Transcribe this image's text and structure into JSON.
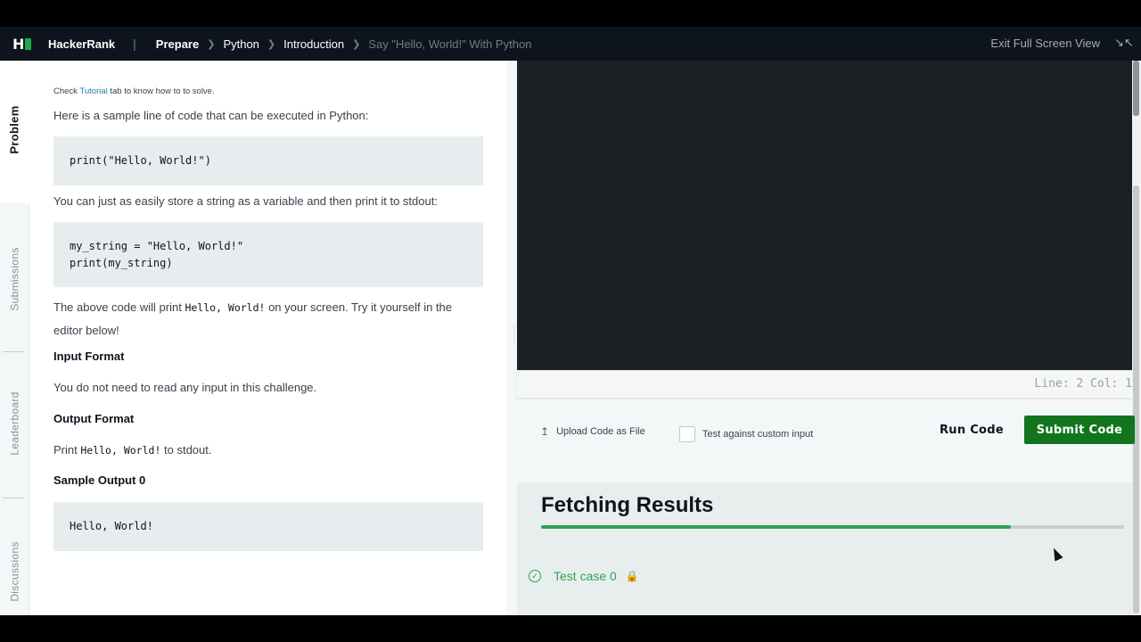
{
  "nav": {
    "brand": "HackerRank",
    "breadcrumbs": [
      "Prepare",
      "Python",
      "Introduction"
    ],
    "current": "Say \"Hello, World!\" With Python",
    "exit_label": "Exit Full Screen View"
  },
  "sidebar": {
    "tabs": [
      "Problem",
      "Submissions",
      "Leaderboard",
      "Discussions"
    ]
  },
  "problem": {
    "hint_prefix": "Check",
    "hint_link": "Tutorial",
    "hint_suffix": "tab to know how to to solve.",
    "intro": "Here is a sample line of code that can be executed in Python:",
    "code1": [
      "print(\"Hello, World!\")"
    ],
    "variable_text": "You can just as easily store a string as a variable and then print it to stdout:",
    "code2": [
      "my_string = \"Hello, World!\"",
      "print(my_string)"
    ],
    "result_prefix": "The above code will print",
    "result_code": "Hello, World!",
    "result_suffix": "on your screen. Try it yourself in the",
    "result_line2": "editor below!",
    "input_heading": "Input Format",
    "input_text": "You do not need to read any input in this challenge.",
    "output_heading": "Output Format",
    "output_prefix": "Print",
    "output_code": "Hello, World!",
    "output_suffix": "to stdout.",
    "sample_heading": "Sample Output 0",
    "sample_code": [
      "Hello, World!"
    ]
  },
  "editor": {
    "status": "Line: 2 Col: 1"
  },
  "actions": {
    "upload_label": "Upload Code as File",
    "custom_input_label": "Test against custom input",
    "run_label": "Run Code",
    "submit_label": "Submit Code"
  },
  "results": {
    "title": "Fetching Results",
    "progress": 0.806,
    "test_case": "Test case 0"
  },
  "colors": {
    "accent": "#1ba94c",
    "submit": "#12751e",
    "nav_bg": "#0e141e"
  }
}
